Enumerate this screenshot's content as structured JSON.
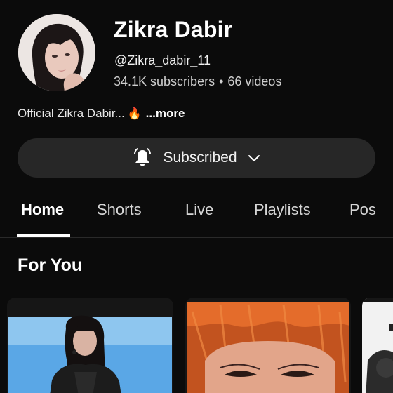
{
  "channel": {
    "name": "Zikra Dabir",
    "handle": "@Zikra_dabir_11",
    "subscribers": "34.1K subscribers",
    "separator": "•",
    "videos": "66 videos",
    "description": "Official Zikra Dabir...",
    "description_emoji": "🔥",
    "more_label": "...more"
  },
  "subscribe": {
    "label": "Subscribed",
    "bell_icon": "bell-ring-icon",
    "chevron_icon": "chevron-down-icon"
  },
  "tabs": [
    {
      "label": "Home",
      "active": true
    },
    {
      "label": "Shorts",
      "active": false
    },
    {
      "label": "Live",
      "active": false
    },
    {
      "label": "Playlists",
      "active": false
    },
    {
      "label": "Pos",
      "active": false
    }
  ],
  "sections": {
    "for_you_title": "For You"
  },
  "colors": {
    "background": "#0b0b0b",
    "pill": "#272727",
    "text_primary": "#ffffff",
    "text_secondary": "#cfcfcf"
  }
}
